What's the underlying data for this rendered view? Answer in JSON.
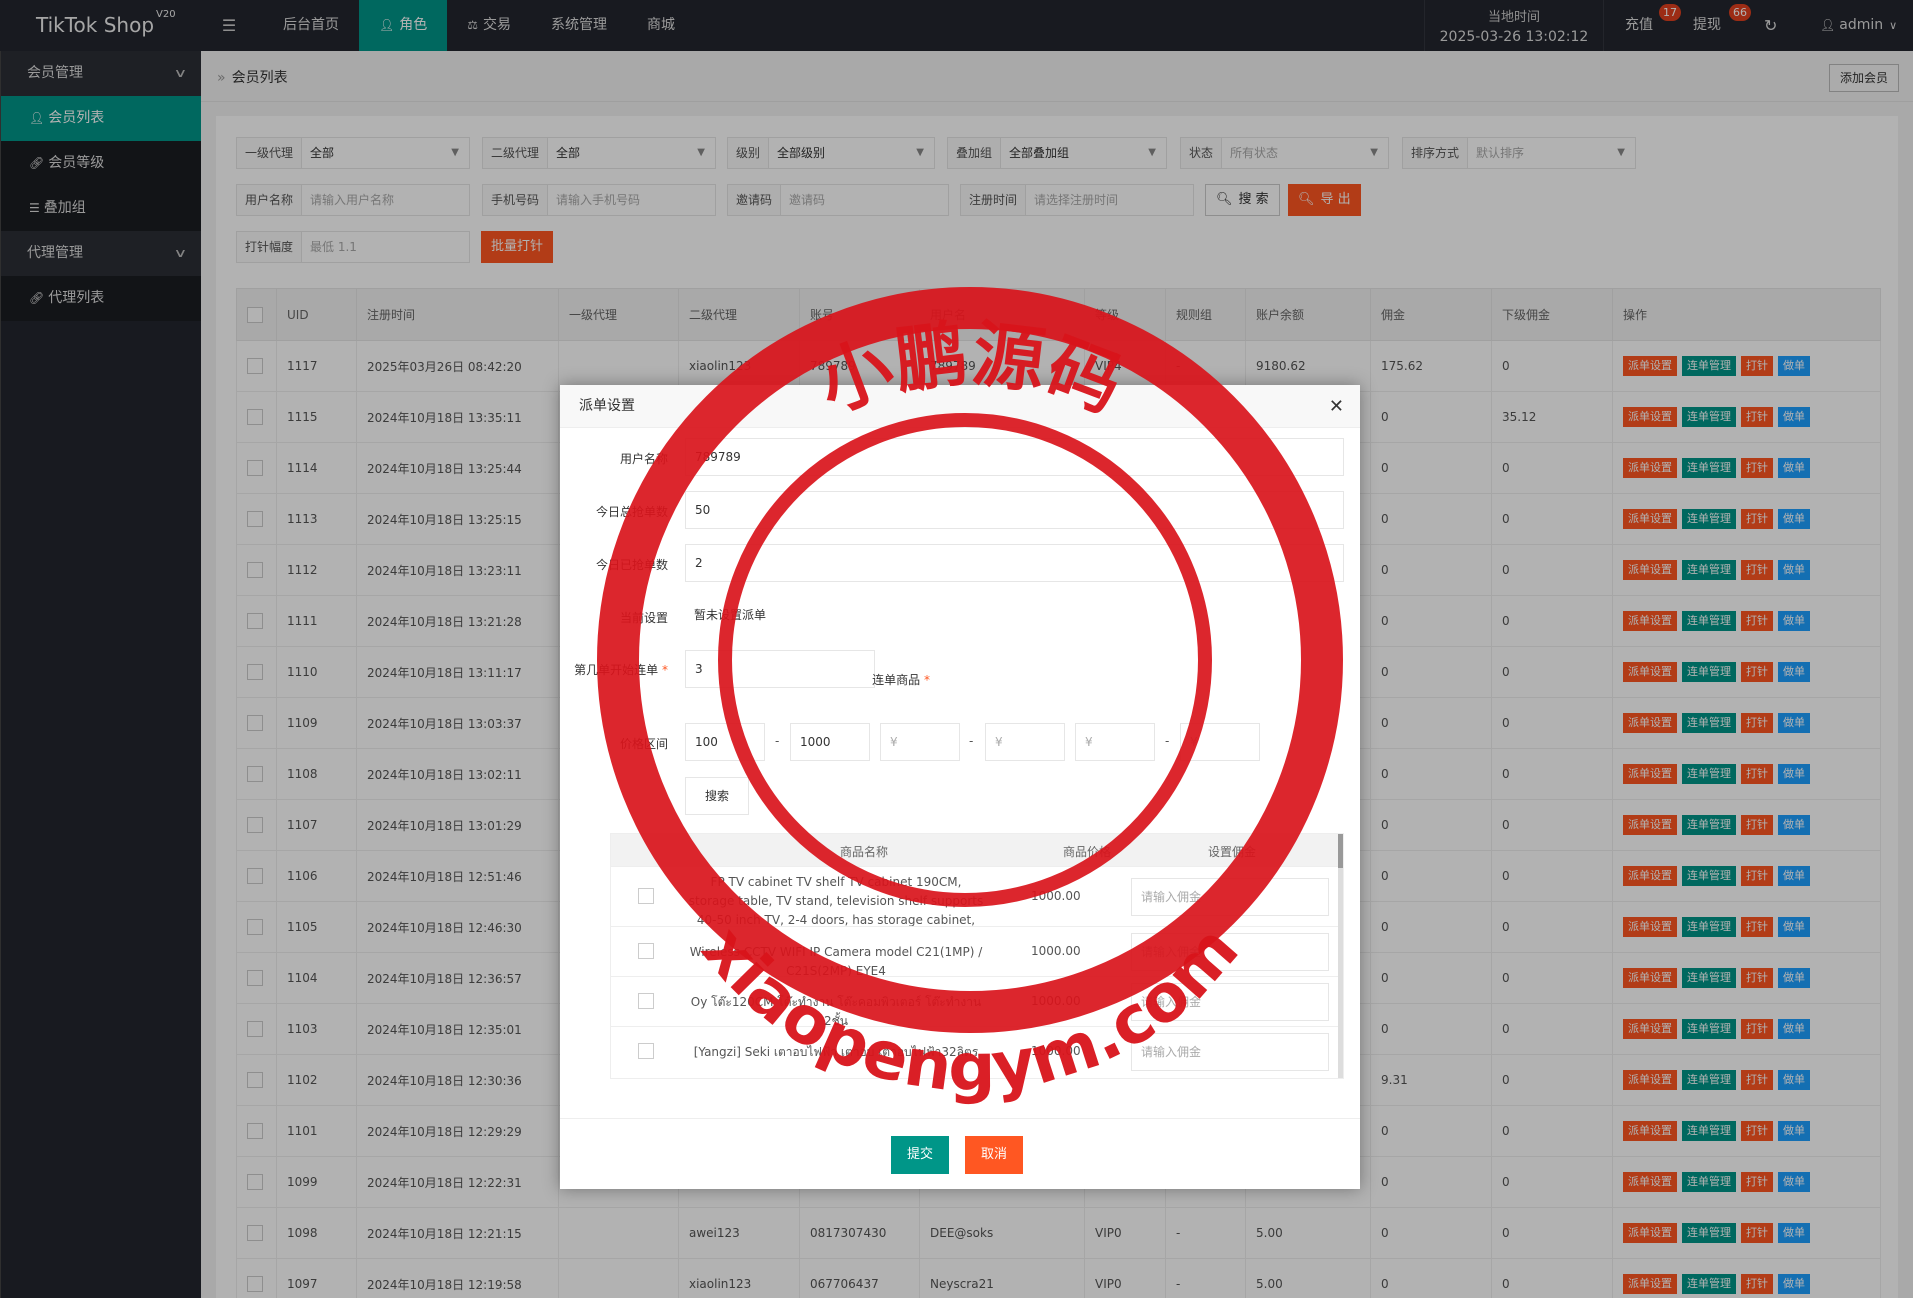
{
  "app": {
    "logo": "TikTok Shop",
    "version": "V20"
  },
  "topnav": [
    {
      "label": "后台首页",
      "icon": ""
    },
    {
      "label": "角色",
      "icon": "user-icon",
      "active": true
    },
    {
      "label": "交易",
      "icon": "scale-icon"
    },
    {
      "label": "系统管理",
      "icon": ""
    },
    {
      "label": "商城",
      "icon": ""
    }
  ],
  "header": {
    "time_label": "当地时间",
    "time_value": "2025-03-26 13:02:12",
    "recharge": "充值",
    "recharge_badge": "17",
    "withdraw": "提现",
    "withdraw_badge": "66",
    "refresh_icon": "refresh-icon",
    "user": "admin"
  },
  "sidebar": {
    "group1": "会员管理",
    "items1": [
      "会员列表",
      "会员等级",
      "叠加组"
    ],
    "group2": "代理管理",
    "items2": [
      "代理列表"
    ]
  },
  "breadcrumb": "会员列表",
  "add_member": "添加会员",
  "filters": {
    "agent1": {
      "label": "一级代理",
      "value": "全部"
    },
    "agent2": {
      "label": "二级代理",
      "value": "全部"
    },
    "level": {
      "label": "级别",
      "value": "全部级别"
    },
    "group": {
      "label": "叠加组",
      "value": "全部叠加组"
    },
    "status": {
      "label": "状态",
      "placeholder": "所有状态"
    },
    "sort": {
      "label": "排序方式",
      "placeholder": "默认排序"
    },
    "username": {
      "label": "用户名称",
      "placeholder": "请输入用户名称"
    },
    "phone": {
      "label": "手机号码",
      "placeholder": "请输入手机号码"
    },
    "invite": {
      "label": "邀请码",
      "placeholder": "邀请码"
    },
    "regtime": {
      "label": "注册时间",
      "placeholder": "请选择注册时间"
    },
    "search_btn": "搜 索",
    "export_btn": "导 出",
    "needle": {
      "label": "打针幅度",
      "placeholder": "最低 1.1"
    },
    "batch_btn": "批量打针"
  },
  "table": {
    "headers": [
      "UID",
      "注册时间",
      "一级代理",
      "二级代理",
      "账号",
      "用户名",
      "等级",
      "规则组",
      "账户余额",
      "佣金",
      "下级佣金",
      "操作"
    ],
    "actions": [
      "派单设置",
      "连单管理",
      "打针",
      "做单"
    ],
    "rows": [
      {
        "uid": "1117",
        "time": "2025年03月26日 08:42:20",
        "a1": "",
        "a2": "xiaolin123",
        "acct": "789789",
        "user": "789789",
        "lvl": "VIP4",
        "rule": "-",
        "bal": "9180.62",
        "com": "175.62",
        "sub": "0"
      },
      {
        "uid": "1115",
        "time": "2024年10月18日 13:35:11",
        "a1": "",
        "a2": "",
        "acct": "",
        "user": "",
        "lvl": "",
        "rule": "",
        "bal": "",
        "com": "0",
        "sub": "35.12"
      },
      {
        "uid": "1114",
        "time": "2024年10月18日 13:25:44",
        "a1": "",
        "a2": "",
        "acct": "",
        "user": "",
        "lvl": "",
        "rule": "",
        "bal": "",
        "com": "0",
        "sub": "0"
      },
      {
        "uid": "1113",
        "time": "2024年10月18日 13:25:15",
        "a1": "",
        "a2": "",
        "acct": "",
        "user": "",
        "lvl": "",
        "rule": "",
        "bal": "",
        "com": "0",
        "sub": "0"
      },
      {
        "uid": "1112",
        "time": "2024年10月18日 13:23:11",
        "a1": "",
        "a2": "",
        "acct": "",
        "user": "",
        "lvl": "",
        "rule": "",
        "bal": "",
        "com": "0",
        "sub": "0"
      },
      {
        "uid": "1111",
        "time": "2024年10月18日 13:21:28",
        "a1": "",
        "a2": "",
        "acct": "",
        "user": "",
        "lvl": "",
        "rule": "",
        "bal": "",
        "com": "0",
        "sub": "0"
      },
      {
        "uid": "1110",
        "time": "2024年10月18日 13:11:17",
        "a1": "",
        "a2": "",
        "acct": "",
        "user": "",
        "lvl": "",
        "rule": "",
        "bal": "",
        "com": "0",
        "sub": "0"
      },
      {
        "uid": "1109",
        "time": "2024年10月18日 13:03:37",
        "a1": "",
        "a2": "",
        "acct": "",
        "user": "",
        "lvl": "",
        "rule": "",
        "bal": "",
        "com": "0",
        "sub": "0"
      },
      {
        "uid": "1108",
        "time": "2024年10月18日 13:02:11",
        "a1": "",
        "a2": "",
        "acct": "",
        "user": "",
        "lvl": "",
        "rule": "",
        "bal": "",
        "com": "0",
        "sub": "0"
      },
      {
        "uid": "1107",
        "time": "2024年10月18日 13:01:29",
        "a1": "",
        "a2": "",
        "acct": "",
        "user": "",
        "lvl": "",
        "rule": "",
        "bal": "",
        "com": "0",
        "sub": "0"
      },
      {
        "uid": "1106",
        "time": "2024年10月18日 12:51:46",
        "a1": "",
        "a2": "",
        "acct": "",
        "user": "",
        "lvl": "",
        "rule": "",
        "bal": "",
        "com": "0",
        "sub": "0"
      },
      {
        "uid": "1105",
        "time": "2024年10月18日 12:46:30",
        "a1": "",
        "a2": "",
        "acct": "",
        "user": "",
        "lvl": "",
        "rule": "",
        "bal": "",
        "com": "0",
        "sub": "0"
      },
      {
        "uid": "1104",
        "time": "2024年10月18日 12:36:57",
        "a1": "",
        "a2": "",
        "acct": "",
        "user": "",
        "lvl": "",
        "rule": "",
        "bal": "",
        "com": "0",
        "sub": "0"
      },
      {
        "uid": "1103",
        "time": "2024年10月18日 12:35:01",
        "a1": "",
        "a2": "",
        "acct": "",
        "user": "",
        "lvl": "",
        "rule": "",
        "bal": "",
        "com": "0",
        "sub": "0"
      },
      {
        "uid": "1102",
        "time": "2024年10月18日 12:30:36",
        "a1": "",
        "a2": "",
        "acct": "",
        "user": "",
        "lvl": "",
        "rule": "",
        "bal": "",
        "com": "9.31",
        "sub": "0"
      },
      {
        "uid": "1101",
        "time": "2024年10月18日 12:29:29",
        "a1": "",
        "a2": "",
        "acct": "",
        "user": "",
        "lvl": "",
        "rule": "",
        "bal": "",
        "com": "0",
        "sub": "0"
      },
      {
        "uid": "1099",
        "time": "2024年10月18日 12:22:31",
        "a1": "",
        "a2": "",
        "acct": "",
        "user": "",
        "lvl": "",
        "rule": "",
        "bal": "",
        "com": "0",
        "sub": "0"
      },
      {
        "uid": "1098",
        "time": "2024年10月18日 12:21:15",
        "a1": "",
        "a2": "awei123",
        "acct": "0817307430",
        "user": "DEE@soks",
        "lvl": "VIP0",
        "rule": "-",
        "bal": "5.00",
        "com": "0",
        "sub": "0"
      },
      {
        "uid": "1097",
        "time": "2024年10月18日 12:19:58",
        "a1": "",
        "a2": "xiaolin123",
        "acct": "067706437",
        "user": "Neyscra21",
        "lvl": "VIP0",
        "rule": "-",
        "bal": "5.00",
        "com": "0",
        "sub": "0"
      }
    ]
  },
  "modal": {
    "title": "派单设置",
    "close_icon": "close-icon",
    "username_label": "用户名称",
    "username_value": "789789",
    "total_label": "今日总抢单数",
    "total_value": "50",
    "done_label": "今日已抢单数",
    "done_value": "2",
    "current_label": "当前设置",
    "current_value": "暂未设置派单",
    "start_label": "第几单开始连单",
    "start_value": "3",
    "goods_label": "连单商品",
    "price_label": "价格区间",
    "price_min": "100",
    "price_max": "1000",
    "price_ph": "¥",
    "search_btn": "搜索",
    "goods_headers": [
      "商品名称",
      "商品价格",
      "设置佣金"
    ],
    "goods": [
      {
        "name": "FP TV cabinet TV shelf TV cabinet 190CM, storage table, TV stand, television shelf supports 40-50 inch TV, 2-4 doors, has storage cabinet, has drawers",
        "price": "1000.00",
        "ph": "请输入佣金"
      },
      {
        "name": "Wireless CCTV WIFI IP Camera model C21(1MP) / C21S(2MP) EYE4",
        "price": "1000.00",
        "ph": "请输入佣金"
      },
      {
        "name": "Oy โต๊ะ120CM โต๊ะทำงาน โต๊ะคอมพิวเตอร์ โต๊ะทำงาน 2ชั้น",
        "price": "1000.00",
        "ph": "请输入佣金"
      },
      {
        "name": "[Yangzi] Seki เตาอบไฟฟ้า เตาอบ เตาอบไฟฟ้า32ลิตร",
        "price": "1000.00",
        "ph": "请输入佣金"
      }
    ],
    "submit": "提交",
    "cancel": "取消"
  },
  "watermark": {
    "top_text": "小鹏源码",
    "bottom_text": "xiaopengym.com"
  },
  "colors": {
    "topbar": "#23262e",
    "accent": "#009688",
    "danger": "#ff5722",
    "info": "#1e9fff",
    "stamp": "#d9141b"
  }
}
